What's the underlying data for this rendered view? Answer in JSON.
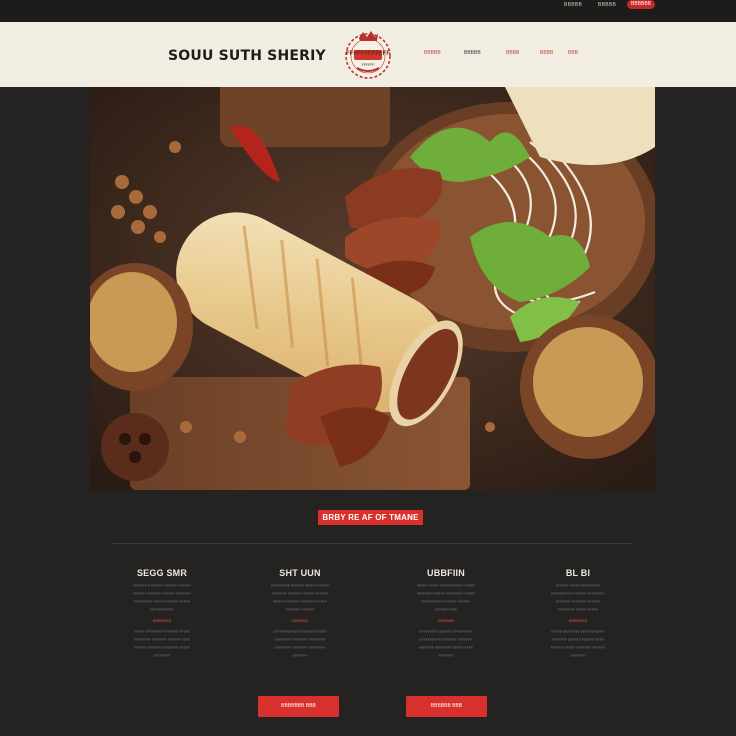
{
  "topbar": {
    "util_1": "BBBBB",
    "util_2": "BBBBB",
    "cta": "BBBBBB"
  },
  "header": {
    "brand": "SOUU SUTH SHERIY",
    "logo_text": "FFFFFFFFFFFF",
    "logo_sub": "FFFFFF",
    "nav": [
      "BBBBB",
      "BBBBB",
      "BBBB",
      "BBBB",
      "BBB"
    ]
  },
  "hero": {
    "image_icon": "wrap-food-photo"
  },
  "section": {
    "badge": "BRBY RE AF OF TMANE"
  },
  "columns": [
    {
      "title": "SEGG SMR",
      "lines_a": [
        "FFFFFFFF FFFFFF FFFFFF FFFFFF",
        "FFFFFF FFFFFFF FFFFFF FFFFFFF",
        "FFFFFFFFF FFFFF FFFFFF FFFFF",
        "FFFFFFFFFFF"
      ],
      "tag": "BBBBBBB",
      "lines_b": [
        "FFFFF FFFFFFFF FFFFFFF FFFFF",
        "FFFFFFFF FFFFFFF FFFFFF FFFF",
        "FFFFFF FFFFFFF FFFFFFF FFFFF",
        "FFFFFFFF"
      ]
    },
    {
      "title": "SHT UUN",
      "lines_a": [
        "FFFFFFFFF FFFFFF FFFFFF FFFFF",
        "FFFFFFF FFFFFF FFFFFF FFFFFF",
        "FFFFFF FFFFFF FFFFFFFF FFFF",
        "FFFFFFF FFFFFF"
      ],
      "tag": "BBBBBB",
      "lines_b": [
        "FFFFFFFFFFFF FFFFFFF FFFFF",
        "FFFFFFFF FFFFFFF FFFFFFFF",
        "FFFFFFFF FFFFFFF FFFFFFFF",
        "FFFFFFF"
      ]
    },
    {
      "title": "UBBFIIN",
      "lines_a": [
        "FFFFF FFFFF FFFFFFFFFFF FFFFF",
        "FFFFFFF FFFFFF FFFFFFFF FFFFF",
        "FFFFFFFFFF FFFFFF FFFFFF",
        "FFFFFF FFFF"
      ],
      "tag": "BBBBBB",
      "lines_b": [
        "FFFFFFFF FFFFFFF FFFFFFFFF",
        "FFFFFFFFFFF FFFFFF FFFFFFF",
        "FFFFFFF FFFFFFFF FFFFF FFFF",
        "FFFFFFF"
      ]
    },
    {
      "title": "BL BI",
      "lines_a": [
        "FFFFFF FFFFF FFFFFFFFF",
        "FFFFFFFFFF FFFFFF FFFFFFFF",
        "FFFFFFF FFFFFFF FFFFFF",
        "FFFFFFFF FFFFF FFFFF"
      ],
      "tag": "BBBBBBB",
      "lines_b": [
        "FFFFF FFFFFFFF FFFFFFFFFFF",
        "FFFFFFF FFFFFF FFFFFF FFFF",
        "FFFFFF FFFFF FFFFFFF FFFFFF",
        "FFFFFFF"
      ]
    }
  ],
  "buttons": [
    "BBBBBBB BBB",
    "BBBBBB BBB"
  ],
  "colors": {
    "accent": "#d8302c",
    "header_bg": "#f1ede2",
    "page_bg": "#242322"
  }
}
